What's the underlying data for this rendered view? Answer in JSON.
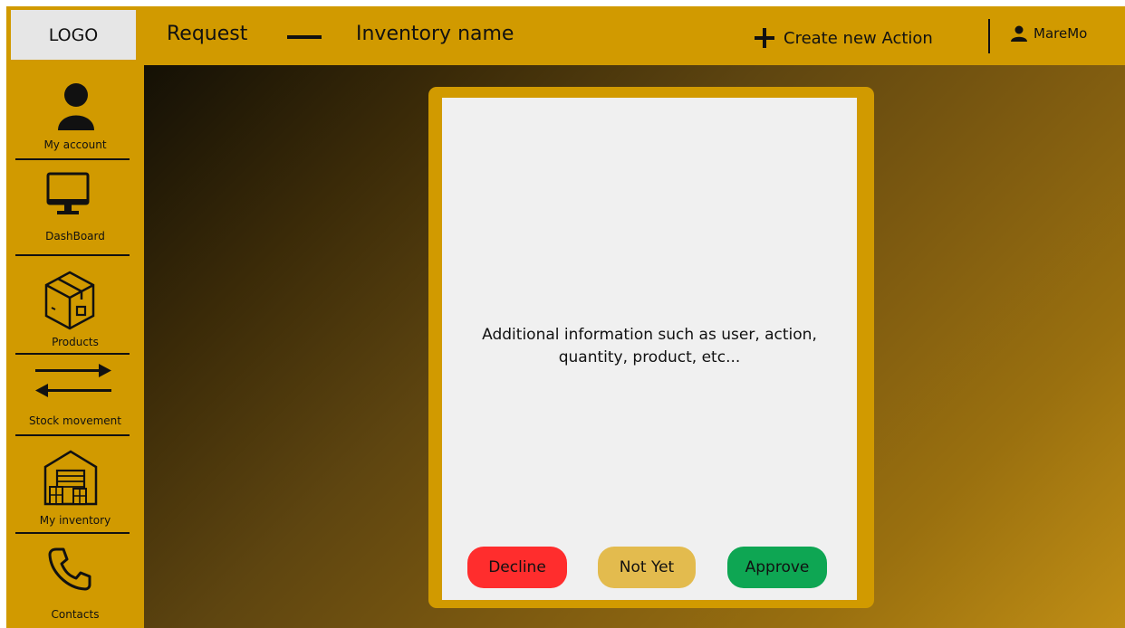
{
  "header": {
    "logo": "LOGO",
    "title_request": "Request",
    "title_inventory": "Inventory name",
    "create_action": "Create new Action",
    "user_name": "MareMo"
  },
  "sidebar": {
    "items": [
      {
        "label": "My account",
        "icon": "person-icon"
      },
      {
        "label": "DashBoard",
        "icon": "monitor-icon"
      },
      {
        "label": "Products",
        "icon": "box-icon"
      },
      {
        "label": "Stock movement",
        "icon": "arrows-icon"
      },
      {
        "label": "My inventory",
        "icon": "warehouse-icon"
      },
      {
        "label": "Contacts",
        "icon": "phone-icon"
      }
    ]
  },
  "modal": {
    "info_line1": "Additional information such as user, action,",
    "info_line2": "quantity, product, etc...",
    "decline_label": "Decline",
    "notyet_label": "Not Yet",
    "approve_label": "Approve"
  },
  "colors": {
    "accent": "#d19a00",
    "decline": "#ff2d2d",
    "not_yet": "#e3bb4e",
    "approve": "#0ea653"
  }
}
